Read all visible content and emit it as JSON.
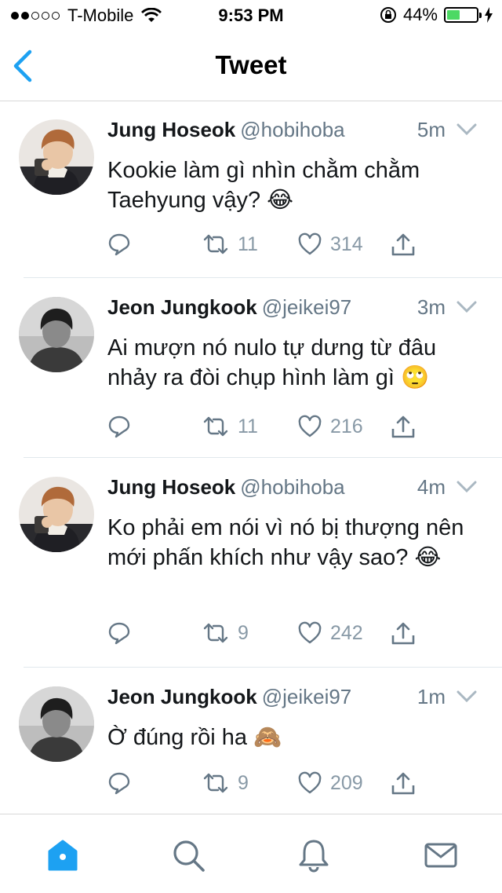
{
  "status": {
    "carrier": "T-Mobile",
    "time": "9:53 PM",
    "battery": "44%",
    "battery_level": 0.44,
    "signal_bars": 2
  },
  "nav": {
    "title": "Tweet"
  },
  "tweets": [
    {
      "name": "Jung Hoseok",
      "handle": "@hobihoba",
      "time": "5m",
      "text": "Kookie làm gì nhìn chằm chằm Taehyung vậy? 😂",
      "retweets": "11",
      "likes": "314"
    },
    {
      "name": "Jeon Jungkook",
      "handle": "@jeikei97",
      "time": "3m",
      "text": "Ai mượn nó nulo tự dưng từ đâu nhảy ra đòi chụp hình làm gì 🙄",
      "retweets": "11",
      "likes": "216"
    },
    {
      "name": "Jung Hoseok",
      "handle": "@hobihoba",
      "time": "4m",
      "text": "Ko phải em nói vì nó bị thượng nên mới phấn khích như vậy sao? 😂",
      "retweets": "9",
      "likes": "242"
    },
    {
      "name": "Jeon Jungkook",
      "handle": "@jeikei97",
      "time": "1m",
      "text": "Ờ đúng rồi ha 🙈",
      "retweets": "9",
      "likes": "209"
    }
  ],
  "colors": {
    "accent": "#1da1f2",
    "icon_gray": "#657786",
    "text": "#14171a"
  }
}
